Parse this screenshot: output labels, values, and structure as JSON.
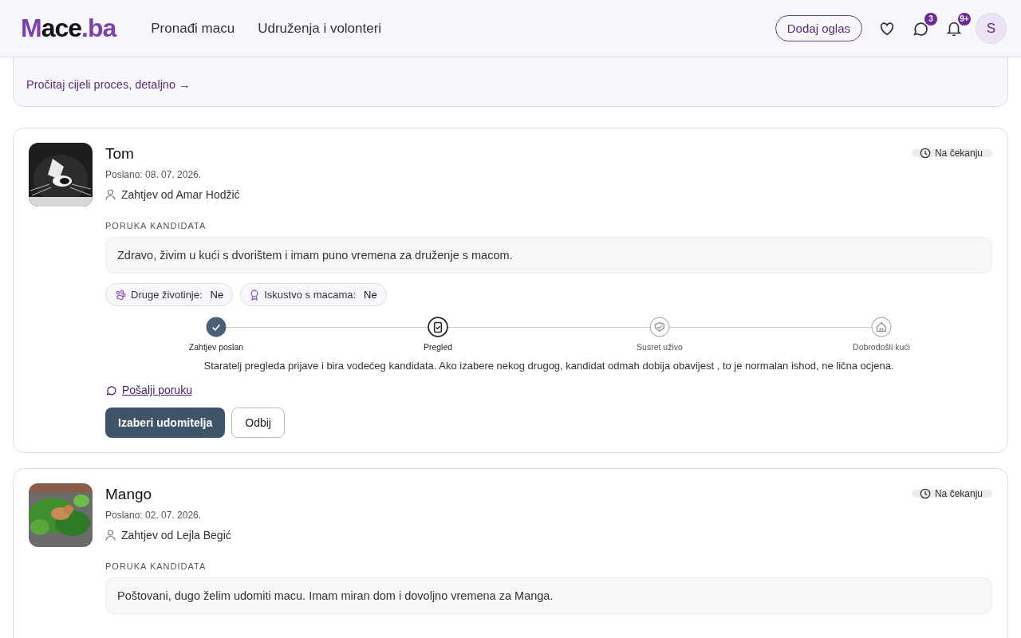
{
  "header": {
    "logo": {
      "first": "Mace",
      "second": ".ba"
    },
    "nav": [
      {
        "label": "Pronađi macu"
      },
      {
        "label": "Udruženja i volonteri"
      }
    ],
    "add_button": "Dodaj oglas",
    "messages_badge": "3",
    "notifications_badge": "9+",
    "avatar": "S"
  },
  "intro": {
    "link": "Pročitaj cijeli proces, detaljno →"
  },
  "requests": [
    {
      "name": "Tom",
      "status": "Na čekanju",
      "sent": "Poslano: 08. 07. 2026.",
      "from": "Zahtjev od Amar Hodžić",
      "message_label": "PORUKA KANDIDATA",
      "message": "Zdravo, živim u kući s dvorištem i imam puno vremena za druženje s macom.",
      "facts": [
        {
          "kind": "animals",
          "label": "Druge životinje:",
          "value": "Ne"
        },
        {
          "kind": "experience",
          "label": "Iskustvo s macama:",
          "value": "Ne"
        }
      ],
      "steps": [
        {
          "label": "Zahtjev poslan",
          "done": true,
          "current": false
        },
        {
          "label": "Pregled",
          "done": false,
          "current": true
        },
        {
          "label": "Susret uživo",
          "done": false,
          "current": false
        },
        {
          "label": "Dobrodošli kući",
          "done": false,
          "current": false
        }
      ],
      "step_note": "Staratelj pregleda prijave i bira vodećeg kandidata. Ako izabere nekog drugog, kandidat odmah dobija obavijest , to je normalan ishod, ne lična ocjena.",
      "send_message": "Pošalji poruku",
      "actions": [
        {
          "kind": "primary",
          "label": "Izaberi udomitelja"
        },
        {
          "kind": "secondary",
          "label": "Odbij"
        }
      ]
    },
    {
      "name": "Mango",
      "status": "Na čekanju",
      "sent": "Poslano: 02. 07. 2026.",
      "from": "Zahtjev od Lejla Begić",
      "message_label": "PORUKA KANDIDATA",
      "message": "Poštovani, dugo želim udomiti macu. Imam miran dom i dovoljno vremena za Manga."
    }
  ]
}
